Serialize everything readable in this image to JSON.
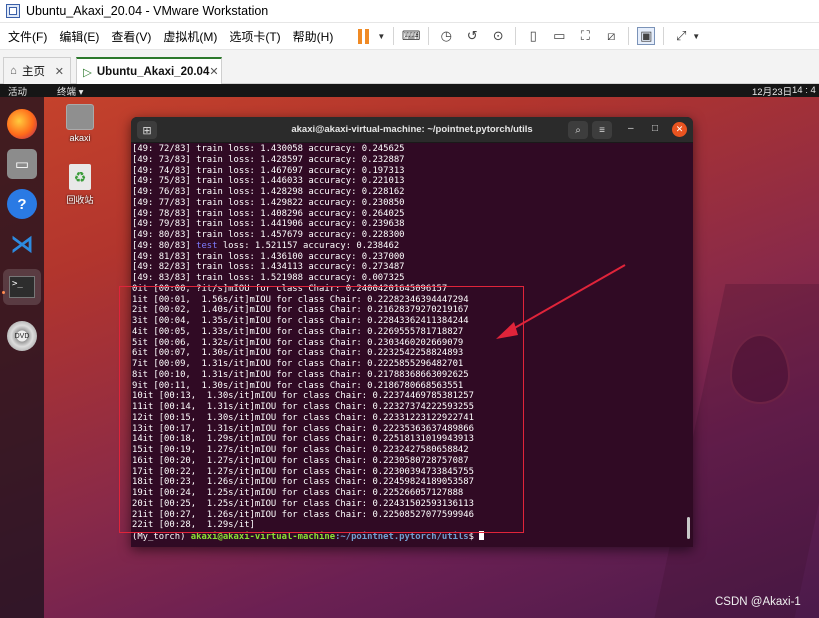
{
  "window": {
    "title": "Ubuntu_Akaxi_20.04 - VMware Workstation"
  },
  "menu": {
    "file": "文件(F)",
    "edit": "编辑(E)",
    "view": "查看(V)",
    "vm": "虚拟机(M)",
    "tabs": "选项卡(T)",
    "help": "帮助(H)"
  },
  "tabs": {
    "home": "主页",
    "vm": "Ubuntu_Akaxi_20.04"
  },
  "ubuntu": {
    "activities": "活动",
    "app_menu": "终端 ▾",
    "date": "12月23日",
    "time": "14 : 4"
  },
  "desktop": {
    "home_label": "akaxi",
    "trash_label": "回收站"
  },
  "terminal": {
    "title": "akaxi@akaxi-virtual-machine: ~/pointnet.pytorch/utils",
    "lines": [
      "[49: 72/83] train loss: 1.430058 accuracy: 0.245625",
      "[49: 73/83] train loss: 1.428597 accuracy: 0.232887",
      "[49: 74/83] train loss: 1.467697 accuracy: 0.197313",
      "[49: 75/83] train loss: 1.446033 accuracy: 0.221013",
      "[49: 76/83] train loss: 1.428298 accuracy: 0.228162",
      "[49: 77/83] train loss: 1.429822 accuracy: 0.230850",
      "[49: 78/83] train loss: 1.408296 accuracy: 0.264025",
      "[49: 79/83] train loss: 1.441906 accuracy: 0.239638",
      "[49: 80/83] train loss: 1.457679 accuracy: 0.228300",
      "[49: 80/83] test loss: 1.521157 accuracy: 0.238462",
      "[49: 81/83] train loss: 1.436100 accuracy: 0.237000",
      "[49: 82/83] train loss: 1.434113 accuracy: 0.273487",
      "[49: 83/83] train loss: 1.521988 accuracy: 0.007325",
      "0it [00:00, ?it/s]mIOU for class Chair: 0.24004201645096157",
      "1it [00:01,  1.56s/it]mIOU for class Chair: 0.22282346394447294",
      "2it [00:02,  1.40s/it]mIOU for class Chair: 0.21628379270219167",
      "3it [00:04,  1.35s/it]mIOU for class Chair: 0.22843362411384244",
      "4it [00:05,  1.33s/it]mIOU for class Chair: 0.2269555781718827",
      "5it [00:06,  1.32s/it]mIOU for class Chair: 0.2303460202669079",
      "6it [00:07,  1.30s/it]mIOU for class Chair: 0.2232542258824893",
      "7it [00:09,  1.31s/it]mIOU for class Chair: 0.2225855296482701",
      "8it [00:10,  1.31s/it]mIOU for class Chair: 0.21788368663092625",
      "9it [00:11,  1.30s/it]mIOU for class Chair: 0.2186780668563551",
      "10it [00:13,  1.30s/it]mIOU for class Chair: 0.22374469785381257",
      "11it [00:14,  1.31s/it]mIOU for class Chair: 0.22327374222593255",
      "12it [00:15,  1.30s/it]mIOU for class Chair: 0.22331223122922741",
      "13it [00:17,  1.31s/it]mIOU for class Chair: 0.22235363637489866",
      "14it [00:18,  1.29s/it]mIOU for class Chair: 0.22518131019943913",
      "15it [00:19,  1.27s/it]mIOU for class Chair: 0.2232427580658842",
      "16it [00:20,  1.27s/it]mIOU for class Chair: 0.2230580728757087",
      "17it [00:22,  1.27s/it]mIOU for class Chair: 0.22300394733845755",
      "18it [00:23,  1.26s/it]mIOU for class Chair: 0.22459824189053587",
      "19it [00:24,  1.25s/it]mIOU for class Chair: 0.225266057127888",
      "20it [00:25,  1.25s/it]mIOU for class Chair: 0.22431502593136113",
      "21it [00:27,  1.26s/it]mIOU for class Chair: 0.22508527077599946",
      "22it [00:28,  1.29s/it]"
    ],
    "prompt": {
      "env": "(My_torch) ",
      "user": "akaxi@akaxi-virtual-machine",
      "path": ":~/pointnet.pytorch/utils",
      "symbol": "$ "
    }
  },
  "watermark": "CSDN @Akaxi-1",
  "colors": {
    "annotation_red": "#e0243a",
    "ubuntu_orange": "#e95420",
    "terminal_bg": "#300a24"
  }
}
